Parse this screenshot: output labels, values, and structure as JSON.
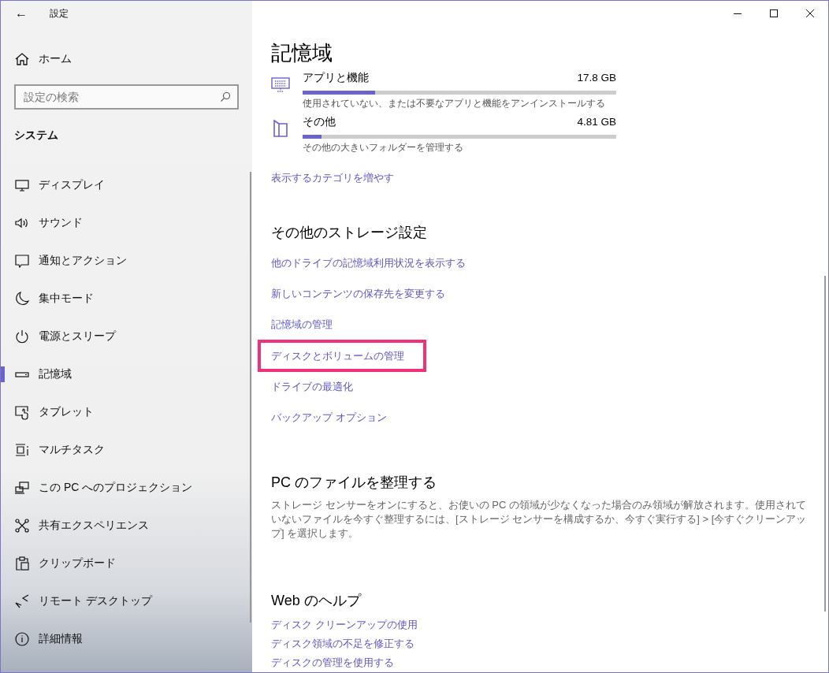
{
  "window": {
    "title": "設定",
    "back": "←"
  },
  "sidebar": {
    "home": "ホーム",
    "search": {
      "placeholder": "設定の検索"
    },
    "section": "システム",
    "items": [
      {
        "label": "ディスプレイ",
        "selected": false
      },
      {
        "label": "サウンド",
        "selected": false
      },
      {
        "label": "通知とアクション",
        "selected": false
      },
      {
        "label": "集中モード",
        "selected": false
      },
      {
        "label": "電源とスリープ",
        "selected": false
      },
      {
        "label": "記憶域",
        "selected": true
      },
      {
        "label": "タブレット",
        "selected": false
      },
      {
        "label": "マルチタスク",
        "selected": false
      },
      {
        "label": "この PC へのプロジェクション",
        "selected": false
      },
      {
        "label": "共有エクスペリエンス",
        "selected": false
      },
      {
        "label": "クリップボード",
        "selected": false
      },
      {
        "label": "リモート デスクトップ",
        "selected": false
      },
      {
        "label": "詳細情報",
        "selected": false
      }
    ]
  },
  "main": {
    "title": "記憶域",
    "categories": [
      {
        "name": "アプリと機能",
        "size": "17.8 GB",
        "level": 0.23,
        "description": "使用されていない、または不要なアプリと機能をアンインストールする"
      },
      {
        "name": "その他",
        "size": "4.81 GB",
        "level": 0.06,
        "description": "その他の大きいフォルダーを管理する"
      }
    ],
    "more_link": "表示するカテゴリを増やす",
    "other_settings": {
      "heading": "その他のストレージ設定",
      "links": [
        {
          "label": "他のドライブの記憶域利用状況を表示する",
          "highlighted": false
        },
        {
          "label": "新しいコンテンツの保存先を変更する",
          "highlighted": false
        },
        {
          "label": "記憶域の管理",
          "highlighted": false
        },
        {
          "label": "ディスクとボリュームの管理",
          "highlighted": true
        },
        {
          "label": "ドライブの最適化",
          "highlighted": false
        },
        {
          "label": "バックアップ オプション",
          "highlighted": false
        }
      ]
    },
    "cleanup": {
      "heading": "PC のファイルを整理する",
      "text": "ストレージ センサーをオンにすると、お使いの PC の領域が少なくなった場合のみ領域が解放されます。使用されていないファイルを今すぐ整理するには、[ストレージ センサーを構成するか、今すぐ実行する] > [今すぐクリーンアップ] を選択します。"
    },
    "help": {
      "heading": "Web のヘルプ",
      "links": [
        "ディスク クリーンアップの使用",
        "ディスク領域の不足を修正する",
        "ディスクの管理を使用する"
      ]
    }
  }
}
